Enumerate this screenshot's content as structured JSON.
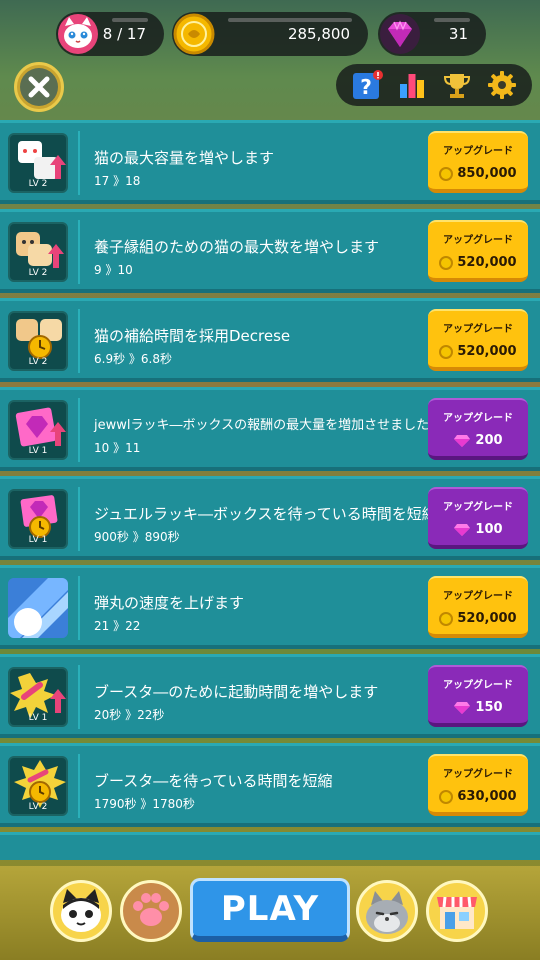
{
  "top": {
    "cats": "8 / 17",
    "coins": "285,800",
    "gems": "31"
  },
  "list": [
    {
      "title": "猫の最大容量を増やします",
      "sub": "17 》18",
      "lv": "LV 2",
      "currency": "coin",
      "btn_label": "アップグレード",
      "price": "850,000",
      "icon": "cat-capacity-icon"
    },
    {
      "title": "養子縁組のための猫の最大数を増やします",
      "sub": "9 》10",
      "lv": "LV 2",
      "currency": "coin",
      "btn_label": "アップグレード",
      "price": "520,000",
      "icon": "adoption-cat-icon"
    },
    {
      "title": "猫の補給時間を採用Decrese",
      "sub": "6.9秒 》6.8秒",
      "lv": "LV 2",
      "currency": "coin",
      "btn_label": "アップグレード",
      "price": "520,000",
      "icon": "cat-timer-icon"
    },
    {
      "title": "jewwlラッキ―ボックスの報酬の最大量を増加させました",
      "sub": "10 》11",
      "lv": "LV 1",
      "currency": "gem",
      "btn_label": "アップグレード",
      "price": "200",
      "icon": "jewel-box-icon"
    },
    {
      "title": "ジュエルラッキ―ボックスを待っている時間を短縮",
      "sub": "900秒 》890秒",
      "lv": "LV 1",
      "currency": "gem",
      "btn_label": "アップグレード",
      "price": "100",
      "icon": "jewel-timer-icon"
    },
    {
      "title": "弾丸の速度を上げます",
      "sub": "21 》22",
      "lv": "",
      "currency": "coin",
      "btn_label": "アップグレード",
      "price": "520,000",
      "icon": "bullet-speed-icon"
    },
    {
      "title": "ブースタ―のために起動時間を増やします",
      "sub": "20秒 》22秒",
      "lv": "LV 1",
      "currency": "gem",
      "btn_label": "アップグレード",
      "price": "150",
      "icon": "booster-duration-icon"
    },
    {
      "title": "ブースタ―を待っている時間を短縮",
      "sub": "1790秒 》1780秒",
      "lv": "LV 2",
      "currency": "coin",
      "btn_label": "アップグレード",
      "price": "630,000",
      "icon": "booster-timer-icon"
    }
  ],
  "bottom": {
    "play_label": "PLAY"
  },
  "colors": {
    "row": "#1f8f99",
    "coin_button": "#ffc20e",
    "gem_button": "#8a2ab8",
    "play_button": "#2f95e8"
  }
}
